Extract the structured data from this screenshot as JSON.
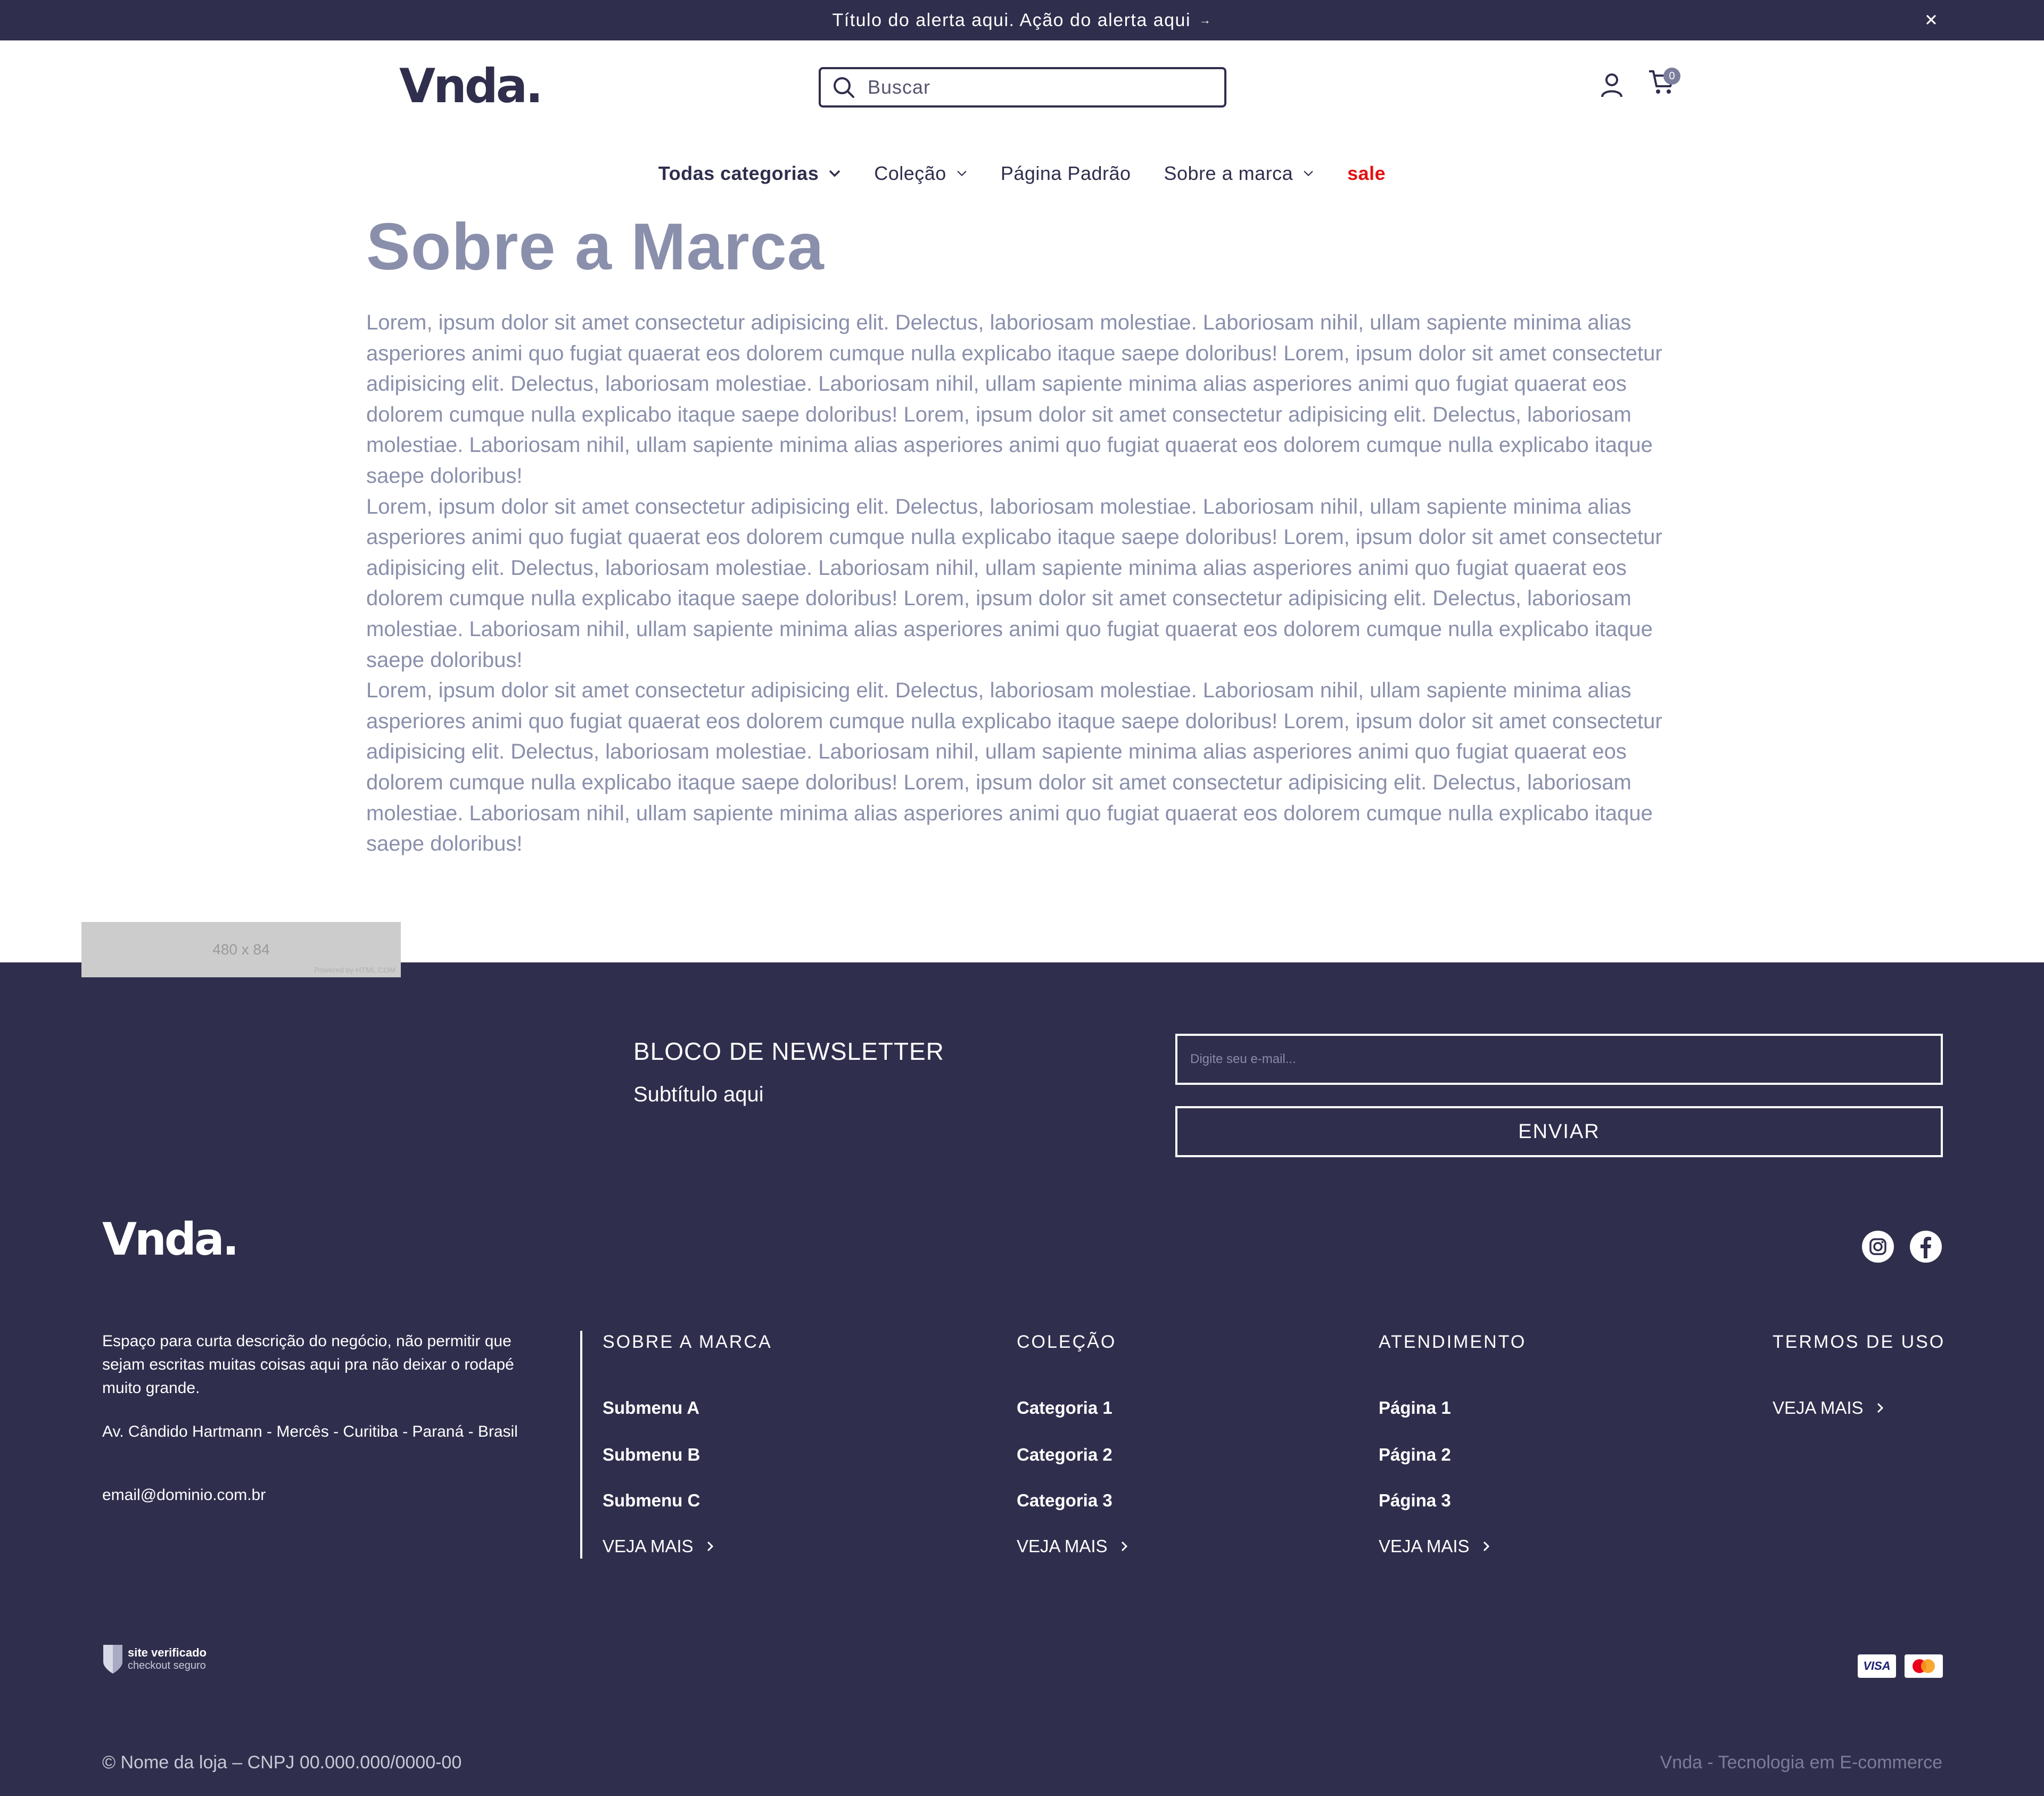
{
  "alert": {
    "text": "Título do alerta aqui. Ação do alerta aqui"
  },
  "header": {
    "logo": "Vnda.",
    "search_placeholder": "Buscar",
    "cart_count": "0"
  },
  "nav": {
    "items": [
      {
        "label": "Todas categorias"
      },
      {
        "label": "Coleção"
      },
      {
        "label": "Página Padrão"
      },
      {
        "label": "Sobre a marca"
      },
      {
        "label": "sale"
      }
    ]
  },
  "page": {
    "title": "Sobre a Marca",
    "paragraphs": [
      "Lorem, ipsum dolor sit amet consectetur adipisicing elit. Delectus, laboriosam molestiae. Laboriosam nihil, ullam sapiente minima alias asperiores animi quo fugiat quaerat eos dolorem cumque nulla explicabo itaque saepe doloribus! Lorem, ipsum dolor sit amet consectetur adipisicing elit. Delectus, laboriosam molestiae. Laboriosam nihil, ullam sapiente minima alias asperiores animi quo fugiat quaerat eos dolorem cumque nulla explicabo itaque saepe doloribus! Lorem, ipsum dolor sit amet consectetur adipisicing elit. Delectus, laboriosam molestiae. Laboriosam nihil, ullam sapiente minima alias asperiores animi quo fugiat quaerat eos dolorem cumque nulla explicabo itaque saepe doloribus!",
      "Lorem, ipsum dolor sit amet consectetur adipisicing elit. Delectus, laboriosam molestiae. Laboriosam nihil, ullam sapiente minima alias asperiores animi quo fugiat quaerat eos dolorem cumque nulla explicabo itaque saepe doloribus! Lorem, ipsum dolor sit amet consectetur adipisicing elit. Delectus, laboriosam molestiae. Laboriosam nihil, ullam sapiente minima alias asperiores animi quo fugiat quaerat eos dolorem cumque nulla explicabo itaque saepe doloribus! Lorem, ipsum dolor sit amet consectetur adipisicing elit. Delectus, laboriosam molestiae. Laboriosam nihil, ullam sapiente minima alias asperiores animi quo fugiat quaerat eos dolorem cumque nulla explicabo itaque saepe doloribus!",
      "Lorem, ipsum dolor sit amet consectetur adipisicing elit. Delectus, laboriosam molestiae. Laboriosam nihil, ullam sapiente minima alias asperiores animi quo fugiat quaerat eos dolorem cumque nulla explicabo itaque saepe doloribus! Lorem, ipsum dolor sit amet consectetur adipisicing elit. Delectus, laboriosam molestiae. Laboriosam nihil, ullam sapiente minima alias asperiores animi quo fugiat quaerat eos dolorem cumque nulla explicabo itaque saepe doloribus! Lorem, ipsum dolor sit amet consectetur adipisicing elit. Delectus, laboriosam molestiae. Laboriosam nihil, ullam sapiente minima alias asperiores animi quo fugiat quaerat eos dolorem cumque nulla explicabo itaque saepe doloribus!"
    ]
  },
  "banner_placeholder": {
    "size_label": "480 x 84",
    "powered": "Powered by HTML.COM"
  },
  "newsletter": {
    "title": "BLOCO DE NEWSLETTER",
    "subtitle": "Subtítulo aqui",
    "email_placeholder": "Digite seu e-mail...",
    "button": "ENVIAR"
  },
  "footer": {
    "logo": "Vnda.",
    "social": [
      "instagram-icon",
      "facebook-icon"
    ],
    "description": "Espaço para curta descrição do negócio, não permitir que sejam escritas muitas coisas aqui pra não deixar o rodapé muito grande.",
    "address": "Av. Cândido Hartmann - Mercês - Curitiba - Paraná - Brasil",
    "email": "email@dominio.com.br",
    "columns": [
      {
        "title": "SOBRE A MARCA",
        "items": [
          "Submenu A",
          "Submenu B",
          "Submenu C"
        ],
        "more": "VEJA MAIS"
      },
      {
        "title": "COLEÇÃO",
        "items": [
          "Categoria 1",
          "Categoria 2",
          "Categoria 3"
        ],
        "more": "VEJA MAIS"
      },
      {
        "title": "ATENDIMENTO",
        "items": [
          "Página 1",
          "Página 2",
          "Página 3"
        ],
        "more": "VEJA MAIS"
      },
      {
        "title": "TERMOS DE USO",
        "items": [],
        "more": "VEJA MAIS"
      }
    ],
    "seal": {
      "line1": "site verificado",
      "line2": "checkout seguro"
    },
    "payments": [
      "VISA",
      "mastercard"
    ],
    "copyright": "© Nome da loja – CNPJ 00.000.000/0000-00",
    "credit": "Vnda - Tecnologia em E-commerce"
  },
  "colors": {
    "primary_dark": "#2f2e4d",
    "text_muted": "#8a8fab",
    "sale": "#e41111"
  }
}
